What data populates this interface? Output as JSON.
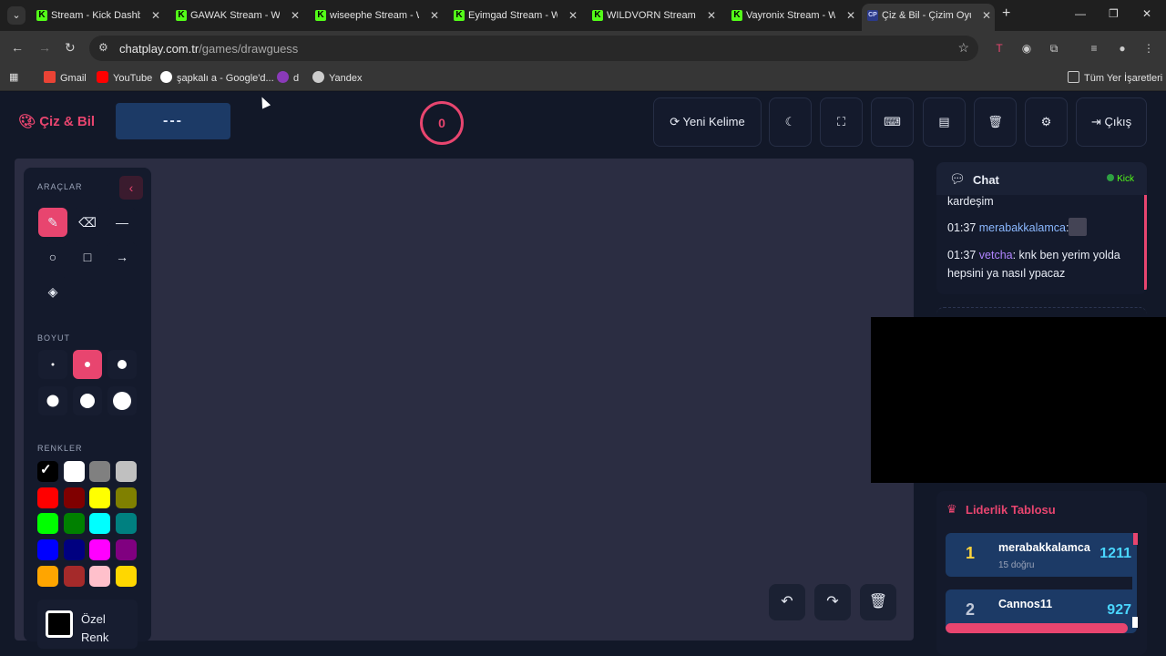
{
  "browser": {
    "tabs": [
      {
        "label": "Stream - Kick Dashboard"
      },
      {
        "label": "GAWAK Stream - Watch"
      },
      {
        "label": "wiseephe Stream - Watch"
      },
      {
        "label": "Eyimgad Stream - Watch"
      },
      {
        "label": "WILDVORN Stream - Watch"
      },
      {
        "label": "Vayronix Stream - Watch"
      },
      {
        "label": "Çiz & Bil - Çizim Oyunu"
      }
    ],
    "active_tab_icon": "CP",
    "url_host": "chatplay.com.tr",
    "url_path": "/games/drawguess",
    "bookmarks": [
      {
        "label": "Gmail"
      },
      {
        "label": "YouTube"
      },
      {
        "label": "şapkalı a - Google'd..."
      },
      {
        "label": "d"
      },
      {
        "label": "Yandex"
      }
    ],
    "all_bookmarks": "Tüm Yer İşaretleri"
  },
  "app": {
    "logo": "Çiz & Bil",
    "word": "---",
    "timer": "0",
    "buttons": {
      "new_word": "Yeni Kelime",
      "logout": "Çıkış"
    }
  },
  "tools": {
    "section_tools": "ARAÇLAR",
    "section_size": "BOYUT",
    "section_colors": "RENKLER",
    "custom_color": "Özel Renk",
    "colors": [
      "#000000",
      "#ffffff",
      "#808080",
      "#c0c0c0",
      "#ff0000",
      "#800000",
      "#ffff00",
      "#808000",
      "#00ff00",
      "#008000",
      "#00ffff",
      "#008080",
      "#0000ff",
      "#000080",
      "#ff00ff",
      "#800080",
      "#ffa500",
      "#a52a2a",
      "#ffc0cb",
      "#ffd700"
    ]
  },
  "chat": {
    "title": "Chat",
    "platform": "Kick",
    "messages": [
      {
        "text": "kardeşim"
      },
      {
        "time": "01:37",
        "user": "merabakkalamca",
        "text": ":"
      },
      {
        "time": "01:37",
        "user": "vetcha",
        "text": ": knk ben yerim yolda hepsini ya nasıl ypacaz"
      }
    ]
  },
  "leaderboard": {
    "title": "Liderlik Tablosu",
    "entries": [
      {
        "rank": "1",
        "name": "merabakkalamca",
        "sub": "15 doğru",
        "score": "1211",
        "color": "#ffd43b"
      },
      {
        "rank": "2",
        "name": "Cannos11",
        "sub": "",
        "score": "927",
        "color": "#c0c8d8"
      }
    ]
  }
}
